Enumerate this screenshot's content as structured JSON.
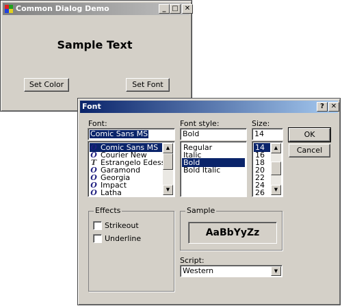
{
  "demo_window": {
    "title": "Common Dialog Demo",
    "sample_text": "Sample Text",
    "set_color_label": "Set Color",
    "set_font_label": "Set Font",
    "minimize_glyph": "_",
    "maximize_glyph": "□",
    "close_glyph": "✕"
  },
  "font_dialog": {
    "title": "Font",
    "help_glyph": "?",
    "close_glyph": "✕",
    "font": {
      "label": "Font:",
      "value": "Comic Sans MS",
      "items": [
        {
          "label": "Comic Sans MS",
          "icon": "opentype-icon",
          "selected": true
        },
        {
          "label": "Courier New",
          "icon": "opentype-icon",
          "selected": false
        },
        {
          "label": "Estrangelo Edessa",
          "icon": "truetype-icon",
          "selected": false
        },
        {
          "label": "Garamond",
          "icon": "opentype-icon",
          "selected": false
        },
        {
          "label": "Georgia",
          "icon": "opentype-icon",
          "selected": false
        },
        {
          "label": "Impact",
          "icon": "opentype-icon",
          "selected": false
        },
        {
          "label": "Latha",
          "icon": "opentype-icon",
          "selected": false
        }
      ]
    },
    "style": {
      "label": "Font style:",
      "value": "Bold",
      "items": [
        {
          "label": "Regular",
          "selected": false
        },
        {
          "label": "Italic",
          "selected": false
        },
        {
          "label": "Bold",
          "selected": true
        },
        {
          "label": "Bold Italic",
          "selected": false
        }
      ]
    },
    "size": {
      "label": "Size:",
      "value": "14",
      "items": [
        {
          "label": "14",
          "selected": true
        },
        {
          "label": "16",
          "selected": false
        },
        {
          "label": "18",
          "selected": false
        },
        {
          "label": "20",
          "selected": false
        },
        {
          "label": "22",
          "selected": false
        },
        {
          "label": "24",
          "selected": false
        },
        {
          "label": "26",
          "selected": false
        }
      ]
    },
    "ok_label": "OK",
    "cancel_label": "Cancel",
    "effects": {
      "label": "Effects",
      "strikeout_label": "Strikeout",
      "underline_label": "Underline",
      "strikeout_checked": false,
      "underline_checked": false
    },
    "sample": {
      "label": "Sample",
      "text": "AaBbYyZz"
    },
    "script": {
      "label": "Script:",
      "value": "Western"
    }
  },
  "colors": {
    "selection": "#0a246a",
    "face": "#d4d0c8"
  }
}
